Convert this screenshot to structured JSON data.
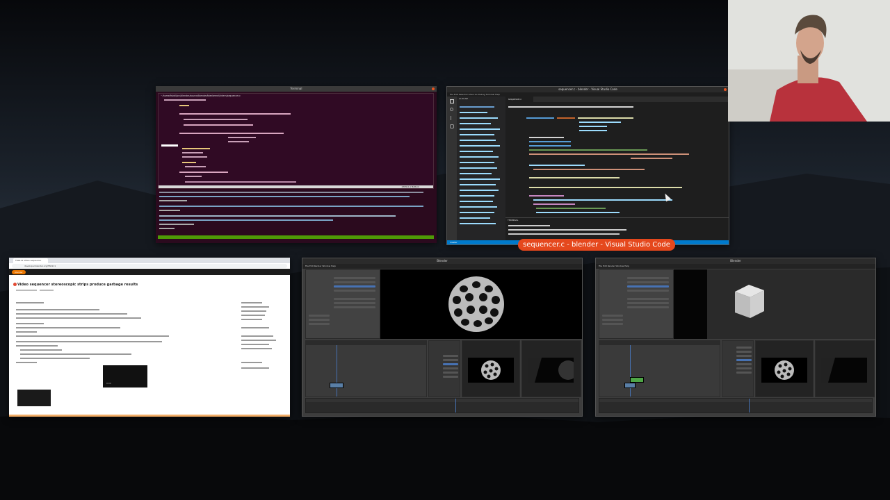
{
  "desktop": {
    "wallpaper": "dark mountain landscape"
  },
  "terminal": {
    "title": "Terminal",
    "file_path": "~/home/fsiddi/src/blender/source/blender/blenkernel/intern/sequencer.c",
    "status_position": "2705,0-1    Bottom",
    "accent_color": "#4e9a06",
    "background_color": "#300a24"
  },
  "vscode": {
    "title": "sequencer.c - blender - Visual Studio Code",
    "menu": "File  Edit  Selection  View  Go  Debug  Terminal  Help",
    "sidebar_header": "OUTLINE",
    "tab_label": "sequencer.c",
    "panel_tab": "TERMINAL",
    "status_text": "master",
    "accent_color": "#007acc"
  },
  "vscode_label": {
    "text": "sequencer.c - blender - Visual Studio Code",
    "color": "#e5481d"
  },
  "browser": {
    "tab_title": "T60111 Video sequencer",
    "url": "developer.blender.org/T60111",
    "logo_text": "blender",
    "page_title": "Video sequencer stereoscopic strips produce garbage results",
    "video_time": "0:00",
    "accent_color": "#ea7600"
  },
  "blender_windows": [
    {
      "title": "Blender",
      "menu": "File  Edit  Render  Window  Help",
      "preview_object": "wireframe sphere",
      "strip_color": "#5a7fa6",
      "playhead_color": "#4772b3"
    },
    {
      "title": "Blender",
      "menu": "File  Edit  Render  Window  Help",
      "preview_object": "cube",
      "strip_color": "#4ea646",
      "playhead_color": "#4772b3"
    }
  ],
  "webcam": {
    "description_icon": "person-icon"
  }
}
